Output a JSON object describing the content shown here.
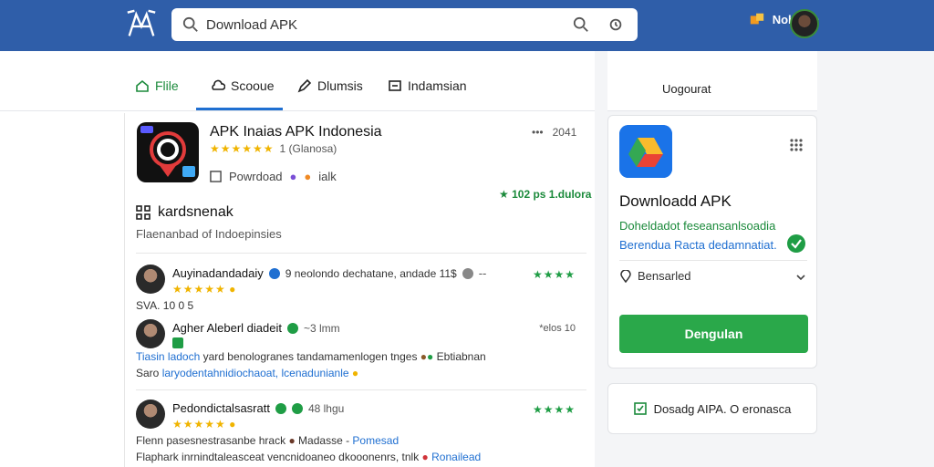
{
  "header": {
    "search": {
      "value": "Download APK",
      "placeholder": "Download APK"
    },
    "user_name": "Nobloae"
  },
  "tabs": [
    {
      "label": "Flile",
      "icon": "home-icon"
    },
    {
      "label": "Scooue",
      "icon": "cloud-icon"
    },
    {
      "label": "Dlumsis",
      "icon": "pen-icon"
    },
    {
      "label": "Indamsian",
      "icon": "window-icon"
    }
  ],
  "app": {
    "title": "APK Inaias APK Indonesia",
    "rating_count": "1 (Glanosa)",
    "meta_label": "Powrdoad",
    "meta_talk": "ialk",
    "more_text": "2041",
    "downloads": "102 ps 1.dulora"
  },
  "section": {
    "heading": "kardsnenak",
    "sub": "Flaenanbad of Indoepinsies"
  },
  "reviews": [
    {
      "name": "Auyinadandadaiy",
      "after_name": "9 neolondo dechatane, andade 11$",
      "score": "SVA. 10 0 5",
      "stars": "★★★★★",
      "right_stars": "★★★★"
    },
    {
      "name": "Agher Aleberl diadeit",
      "time": "~3 lmm",
      "right_text": "*elos 10",
      "line1_link": "Tiasin ladoch",
      "line1_rest": "yard benologranes tandamamenlogen tnges",
      "line1_end": "Ebtiabnan",
      "line2_start": "Saro",
      "line2_link": "laryodentahnidiochaoat,",
      "line2_end": "lcenadunianle"
    },
    {
      "name": "Pedondictalsasratt",
      "time": "48 lhgu",
      "right_stars": "★★★★",
      "stars": "★★★★★",
      "line1_start": "Flenn pasesnestrasanbe hrack",
      "line1_mid": "Madasse -",
      "line1_link": "Pomesad",
      "line2_start": "Flaphark inrnindtaleasceat vencnidoaneo dkooonenrs, tnlk",
      "line2_link": "Ronailead"
    }
  ],
  "side": {
    "top_label": "Uogourat",
    "card_title": "Downloadd APK",
    "line1": "Doheldadot feseansanlsoadia",
    "line2": "Berendua Racta dedamnatiat.",
    "option": "Bensarled",
    "button": "Dengulan",
    "small_card": "Dosadg AIPA. O eronasca"
  },
  "colors": {
    "header": "#2f5ea9",
    "accent_green": "#2aa84a",
    "link_blue": "#1f6fd1",
    "star_yellow": "#f0b400"
  }
}
